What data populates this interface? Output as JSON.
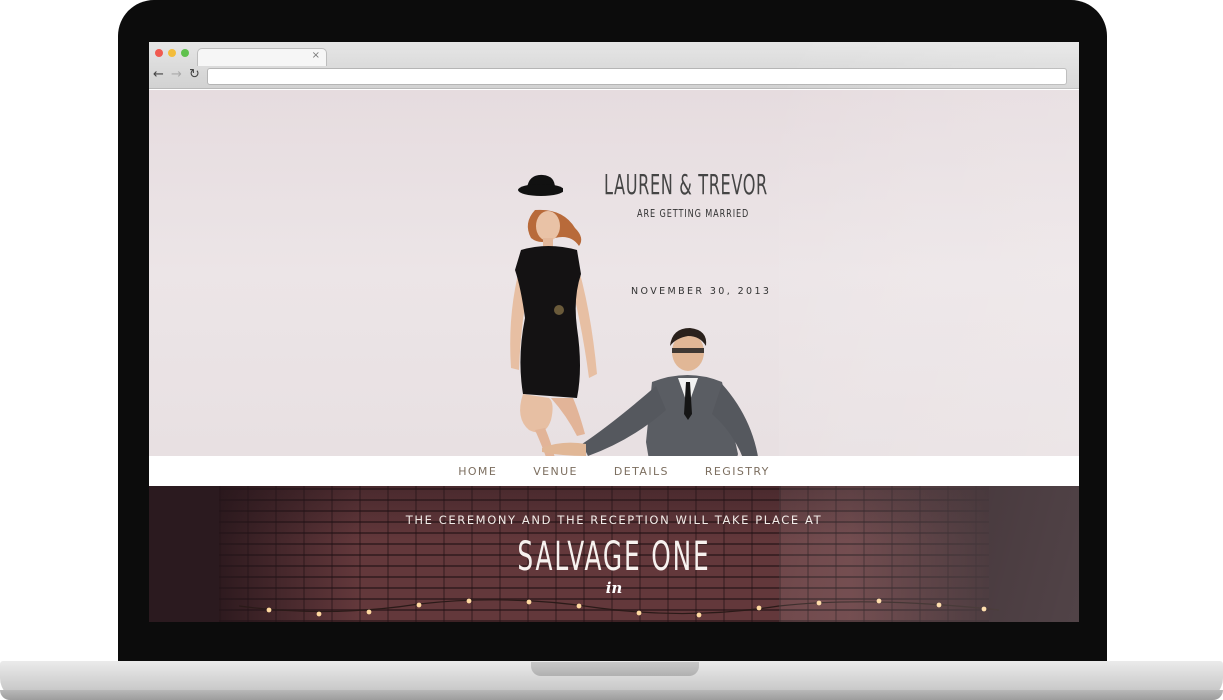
{
  "hero": {
    "title": "LAUREN & TREVOR",
    "subtitle": "ARE GETTING MARRIED",
    "date": "NOVEMBER 30, 2013"
  },
  "nav": {
    "items": [
      "HOME",
      "VENUE",
      "DETAILS",
      "REGISTRY"
    ]
  },
  "venue_section": {
    "intro": "THE CEREMONY AND THE RECEPTION WILL TAKE PLACE AT",
    "name": "SALVAGE ONE",
    "in": "in"
  },
  "browser": {
    "tab_close": "×",
    "back_icon": "←",
    "forward_icon": "→",
    "reload_icon": "↻"
  },
  "colors": {
    "nav_text": "#7c6e5f",
    "hero_bg": "#e9e1e3",
    "band_bg": "#2b1a1f"
  }
}
